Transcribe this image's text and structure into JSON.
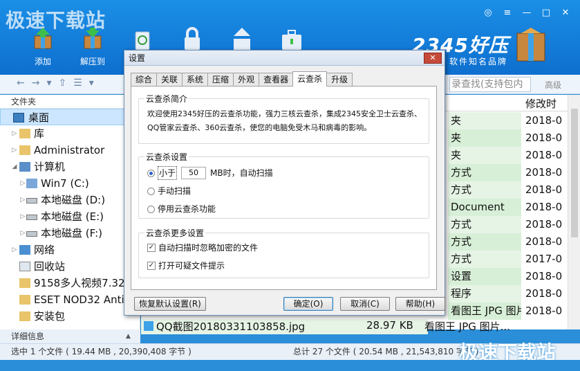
{
  "watermark_top": "极速下载站",
  "watermark_bottom": "极速下载站",
  "toolbar": {
    "add_label": "添加",
    "extract_label": "解压到"
  },
  "brand": {
    "name": "2345好压",
    "slogan": "软件知名品牌"
  },
  "window_controls": [
    "◎",
    "≡",
    "—",
    "□",
    "✕"
  ],
  "search": {
    "placeholder": "录查找(支持包内",
    "advanced": "高级"
  },
  "left_pane": {
    "header": "文件夹",
    "items": [
      {
        "label": "桌面",
        "selected": true
      },
      {
        "label": "库"
      },
      {
        "label": "Administrator"
      },
      {
        "label": "计算机"
      },
      {
        "label": "Win7 (C:)"
      },
      {
        "label": "本地磁盘 (D:)"
      },
      {
        "label": "本地磁盘 (E:)"
      },
      {
        "label": "本地磁盘 (F:)"
      },
      {
        "label": "网络"
      },
      {
        "label": "回收站"
      },
      {
        "label": "9158多人视频7.32"
      },
      {
        "label": "ESET NOD32 Anti"
      },
      {
        "label": "安装包"
      }
    ],
    "detail_label": "详细信息"
  },
  "right_pane": {
    "col_modified": "修改时",
    "rows": [
      {
        "type": "夹",
        "date": "2018-0"
      },
      {
        "type": "夹",
        "date": "2018-0"
      },
      {
        "type": "夹",
        "date": "2018-0"
      },
      {
        "type": "方式",
        "date": "2018-0"
      },
      {
        "type": "方式",
        "date": "2018-0"
      },
      {
        "type": "Document",
        "date": "2018-0"
      },
      {
        "type": "方式",
        "date": "2018-0"
      },
      {
        "type": "方式",
        "date": "2018-0"
      },
      {
        "type": "方式",
        "date": "2017-0"
      },
      {
        "type": "设置",
        "date": "2018-0"
      },
      {
        "type": "程序",
        "date": "2018-0"
      },
      {
        "type": "看图王 JPG 图片...",
        "date": "2018-0"
      }
    ],
    "last_row": {
      "name": "QQ截图20180331103858.jpg",
      "size": "28.97 KB",
      "type": "看图王 JPG 图片...",
      "date": "2018-0"
    }
  },
  "status": {
    "left": "选中 1 个文件 ( 19.44 MB , 20,390,408 字节 )",
    "right": "总计 27 个文件 ( 20.54 MB , 21,543,810 字节 )"
  },
  "dialog": {
    "title": "设置",
    "close": "✕",
    "tabs": [
      "综合",
      "关联",
      "系统",
      "压缩",
      "外观",
      "查看器",
      "云查杀",
      "升级"
    ],
    "active_tab": 6,
    "intro": {
      "title": "云查杀简介",
      "text": "欢迎使用2345好压的云查杀功能，强力三核云查杀，集成2345安全卫士云查杀、QQ管家云查杀、360云查杀，使您的电脑免受木马和病毒的影响。"
    },
    "settings": {
      "title": "云查杀设置",
      "opt1_prefix": "小于",
      "opt1_value": "50",
      "opt1_suffix": "MB时，自动扫描",
      "opt2": "手动扫描",
      "opt3": "停用云查杀功能",
      "selected": 0
    },
    "more": {
      "title": "云查杀更多设置",
      "chk1": "自动扫描时忽略加密的文件",
      "chk2": "打开可疑文件提示"
    },
    "buttons": {
      "restore": "恢复默认设置(R)",
      "ok": "确定(O)",
      "cancel": "取消(C)",
      "help": "帮助(H)"
    }
  }
}
